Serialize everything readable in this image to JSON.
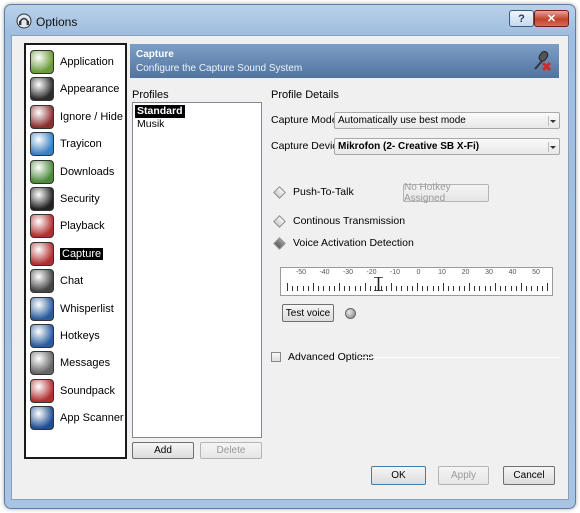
{
  "window": {
    "title": "Options",
    "help_label": "?",
    "close_label": "✕"
  },
  "categories": [
    {
      "label": "Application",
      "icon": "application-icon",
      "color": "#6a9a3a"
    },
    {
      "label": "Appearance",
      "icon": "appearance-icon",
      "color": "#2b2b2b"
    },
    {
      "label": "Ignore / Hide",
      "icon": "ignore-hide-icon",
      "color": "#8a3030"
    },
    {
      "label": "Trayicon",
      "icon": "trayicon-icon",
      "color": "#3a7fbf"
    },
    {
      "label": "Downloads",
      "icon": "downloads-icon",
      "color": "#4a8a3a"
    },
    {
      "label": "Security",
      "icon": "security-icon",
      "color": "#222222"
    },
    {
      "label": "Playback",
      "icon": "playback-icon",
      "color": "#b03030"
    },
    {
      "label": "Capture",
      "icon": "capture-icon",
      "color": "#b03030",
      "selected": true
    },
    {
      "label": "Chat",
      "icon": "chat-icon",
      "color": "#444444"
    },
    {
      "label": "Whisperlist",
      "icon": "whisperlist-icon",
      "color": "#2a5c9a"
    },
    {
      "label": "Hotkeys",
      "icon": "hotkeys-icon",
      "color": "#2a5c9a"
    },
    {
      "label": "Messages",
      "icon": "messages-icon",
      "color": "#666666"
    },
    {
      "label": "Soundpack",
      "icon": "soundpack-icon",
      "color": "#b03030"
    },
    {
      "label": "App Scanner",
      "icon": "app-scanner-icon",
      "color": "#1f4f8f"
    }
  ],
  "banner": {
    "title": "Capture",
    "subtitle": "Configure the Capture Sound System",
    "icon": "microphone-muted-icon"
  },
  "profiles": {
    "label": "Profiles",
    "items": [
      {
        "label": "Standard",
        "selected": true
      },
      {
        "label": "Musik"
      }
    ],
    "add_label": "Add",
    "delete_label": "Delete"
  },
  "details": {
    "label": "Profile Details",
    "capture_mode_label": "Capture Mode:",
    "capture_mode_value": "Automatically use best mode",
    "capture_device_label": "Capture Device:",
    "capture_device_value": "Mikrofon (2- Creative SB X-Fi)",
    "push_to_talk_label": "Push-To-Talk",
    "hotkey_button_label": "No Hotkey Assigned",
    "continuous_label": "Continous Transmission",
    "vad_label": "Voice Activation Detection",
    "vad_selected": true,
    "slider_ticks": [
      "-50",
      "-40",
      "-30",
      "-20",
      "-10",
      "0",
      "10",
      "20",
      "30",
      "40",
      "50"
    ],
    "slider_value": -17,
    "test_voice_label": "Test voice",
    "advanced_label": "Advanced Options"
  },
  "footer": {
    "ok_label": "OK",
    "apply_label": "Apply",
    "cancel_label": "Cancel"
  }
}
